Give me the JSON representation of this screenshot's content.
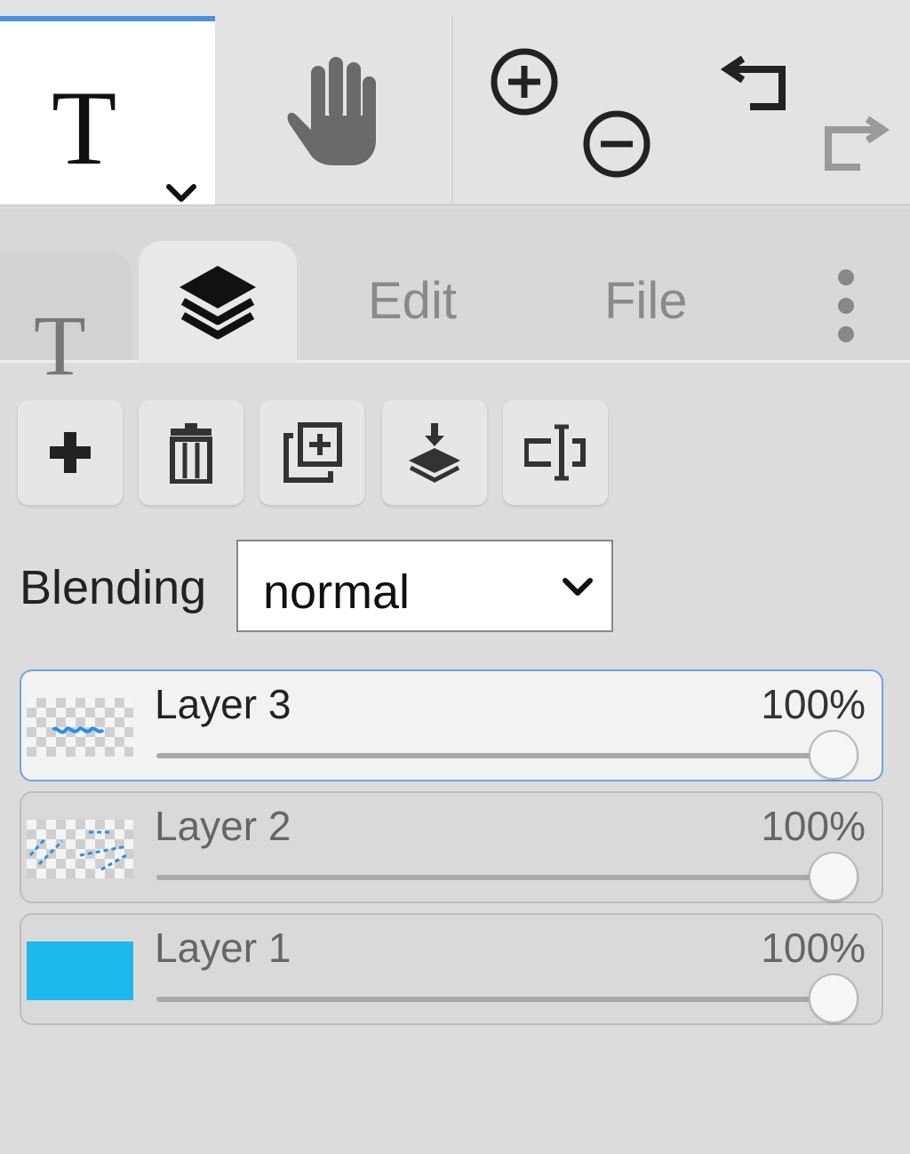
{
  "toolbar": {
    "tools": [
      {
        "name": "text-tool",
        "glyph": "T",
        "icon": "chevron-down-icon",
        "active": true
      },
      {
        "name": "hand-tool",
        "icon": "hand-icon"
      },
      {
        "name": "zoom-in",
        "icon": "zoom-in-icon"
      },
      {
        "name": "zoom-out",
        "icon": "zoom-out-icon"
      },
      {
        "name": "undo",
        "icon": "undo-icon"
      },
      {
        "name": "redo",
        "icon": "redo-icon",
        "disabled": true
      }
    ]
  },
  "tabs": {
    "text_glyph": "T",
    "layers_icon": "layers-icon",
    "edit_label": "Edit",
    "file_label": "File",
    "more_icon": "more-vertical-icon",
    "active": "layers"
  },
  "layer_actions": [
    {
      "name": "add-layer",
      "icon": "plus-icon"
    },
    {
      "name": "delete-layer",
      "icon": "trash-icon"
    },
    {
      "name": "duplicate-layer",
      "icon": "duplicate-icon"
    },
    {
      "name": "merge-down",
      "icon": "merge-down-icon"
    },
    {
      "name": "rename-layer",
      "icon": "text-cursor-icon"
    }
  ],
  "blending": {
    "label": "Blending",
    "value": "normal"
  },
  "layers": [
    {
      "name": "Layer 3",
      "opacity_label": "100%",
      "opacity": 1.0,
      "selected": true,
      "thumb": "transparent-with-text"
    },
    {
      "name": "Layer 2",
      "opacity_label": "100%",
      "opacity": 1.0,
      "selected": false,
      "thumb": "transparent-with-strokes"
    },
    {
      "name": "Layer 1",
      "opacity_label": "100%",
      "opacity": 1.0,
      "selected": false,
      "thumb": "solid-cyan"
    }
  ],
  "colors": {
    "accent": "#4a90e2",
    "layer1_fill": "#1bb8ee",
    "stroke_blue": "#2a8fe6"
  }
}
